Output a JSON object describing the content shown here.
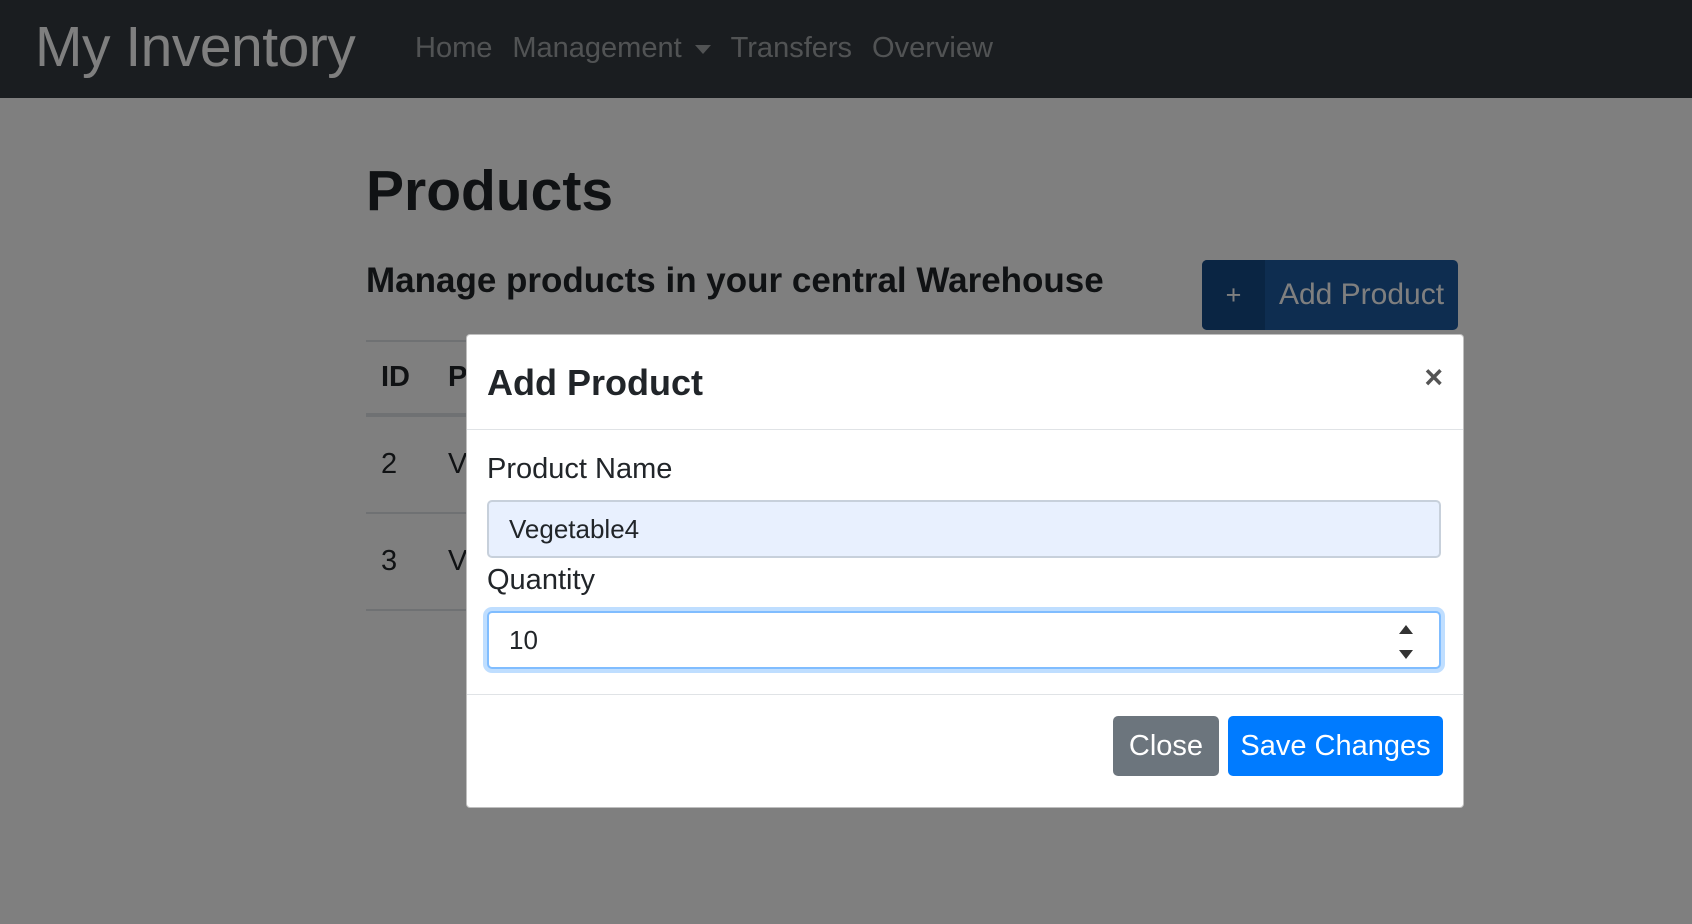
{
  "navbar": {
    "brand": "My Inventory",
    "links": [
      "Home",
      "Management",
      "Transfers",
      "Overview"
    ]
  },
  "page": {
    "title": "Products",
    "subtitle": "Manage products in your central Warehouse",
    "add_button": {
      "icon": "+",
      "label": "Add Product"
    }
  },
  "table": {
    "headers": [
      "ID",
      "P"
    ],
    "rows": [
      [
        "2",
        "V"
      ],
      [
        "3",
        "V"
      ]
    ]
  },
  "modal": {
    "title": "Add Product",
    "close_symbol": "×",
    "fields": {
      "name_label": "Product Name",
      "name_value": "Vegetable4",
      "quantity_label": "Quantity",
      "quantity_value": "10"
    },
    "buttons": {
      "close": "Close",
      "save": "Save Changes"
    }
  },
  "colors": {
    "navbar_bg": "#343a40",
    "primary": "#007bff",
    "secondary": "#6c757d",
    "add_button": "#1d5ba0",
    "autofill_bg": "#e8f0fe"
  }
}
